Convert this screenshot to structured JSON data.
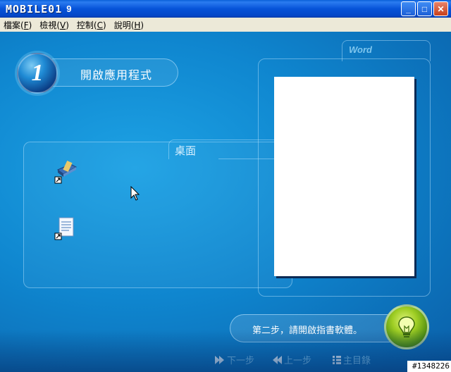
{
  "window": {
    "title_logo": "MOBILE01",
    "title_version": "9",
    "buttons": {
      "minimize": "_",
      "maximize": "□",
      "close": "✕"
    }
  },
  "menu": [
    {
      "label": "檔案",
      "key": "F"
    },
    {
      "label": "檢視",
      "key": "V"
    },
    {
      "label": "控制",
      "key": "C"
    },
    {
      "label": "說明",
      "key": "H"
    }
  ],
  "step": {
    "number": "1",
    "title": "開啟應用程式"
  },
  "desktop": {
    "label": "桌面",
    "icons": [
      {
        "name": "word-shortcut-icon"
      },
      {
        "name": "document-shortcut-icon"
      }
    ]
  },
  "word_panel": {
    "label": "Word"
  },
  "instruction": {
    "text": "第二步，請開啟指書軟體。"
  },
  "nav": {
    "next": "下一步",
    "prev": "上一步",
    "home": "主目錄"
  },
  "watermark": "#1348226",
  "colors": {
    "title_bar": "#0653d8",
    "menu_bar": "#ece9d8",
    "content_bg": "#0f86cf",
    "accent_text": "#7fc6ee",
    "bulb": "#9fce24"
  }
}
